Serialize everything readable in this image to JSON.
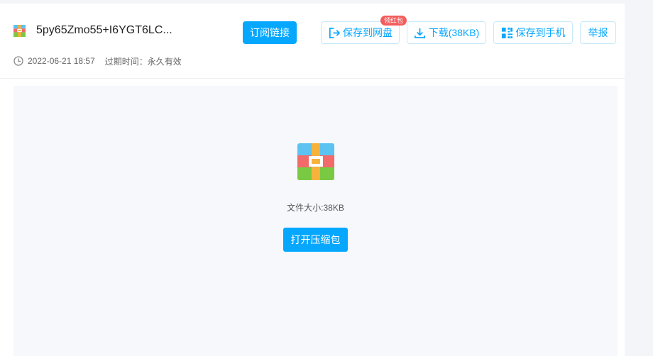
{
  "file": {
    "name": "5py65Zmo55+I6YGT6LC...",
    "date": "2022-06-21 18:57",
    "expire": "过期时间：永久有效",
    "size_text": "文件大小:38KB"
  },
  "actions": {
    "subscribe": "订阅链接",
    "save_to_disk": "保存到网盘",
    "save_badge": "领红包",
    "download": "下载(38KB)",
    "save_to_phone": "保存到手机",
    "report": "举报",
    "open_archive": "打开压缩包"
  },
  "icons": {
    "file_type": "archive-icon",
    "save": "save-to-disk-icon",
    "download": "download-icon",
    "phone": "qr-phone-icon",
    "clock": "clock-icon"
  },
  "colors": {
    "accent": "#06a7ff",
    "badge": "#f25c5c"
  }
}
